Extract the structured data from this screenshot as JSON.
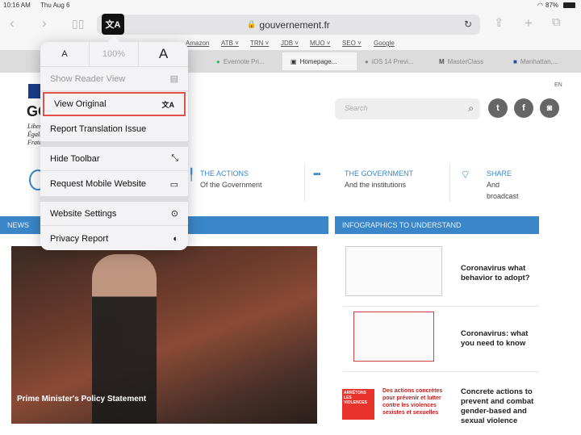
{
  "status": {
    "time": "10:16 AM",
    "date": "Thu Aug 6",
    "battery": "87%"
  },
  "toolbar": {
    "url": "gouvernement.fr",
    "translate_icon": "translate-icon"
  },
  "bookmarks": [
    "Amazon",
    "ATB ˅",
    "TRN ˅",
    "JDB ˅",
    "MUO ˅",
    "SEO ˅",
    "Google"
  ],
  "tabs": [
    {
      "label": "Evernote Pri..."
    },
    {
      "label": "Homepage..."
    },
    {
      "label": "iOS 14 Previ..."
    },
    {
      "label": "MasterClass"
    },
    {
      "label": "Manhattan,..."
    }
  ],
  "menu": {
    "font_small": "A",
    "zoom": "100%",
    "font_large": "A",
    "items": [
      {
        "label": "Show Reader View",
        "disabled": true
      },
      {
        "label": "View Original",
        "highlighted": true
      },
      {
        "label": "Report Translation Issue"
      },
      {
        "label": "Hide Toolbar"
      },
      {
        "label": "Request Mobile Website"
      },
      {
        "label": "Website Settings"
      },
      {
        "label": "Privacy Report"
      }
    ]
  },
  "site": {
    "lang": "EN",
    "logo_text": "GO",
    "motto": [
      "Liberté",
      "Égalité",
      "Fraternité"
    ],
    "search_placeholder": "Search",
    "nav": [
      {
        "title": "THE ACTIONS",
        "sub": "Of the Government"
      },
      {
        "title": "THE GOVERNMENT",
        "sub": "And the institutions"
      },
      {
        "title": "SHARE",
        "sub": "And broadcast"
      }
    ],
    "news_header": "NEWS",
    "news_caption": "Prime Minister's Policy Statement",
    "info_header": "INFOGRAPHICS TO UNDERSTAND",
    "infographics": [
      {
        "title": "Coronavirus what behavior to adopt?"
      },
      {
        "title": "Coronavirus: what you need to know"
      },
      {
        "title": "Concrete actions to prevent and combat gender-based and sexual violence",
        "thumb_badge": "ARRÊTONS LES VIOLENCES",
        "thumb_text": "Des actions concrètes pour prévenir et lutter contre les violences sexistes et sexuelles"
      }
    ]
  }
}
